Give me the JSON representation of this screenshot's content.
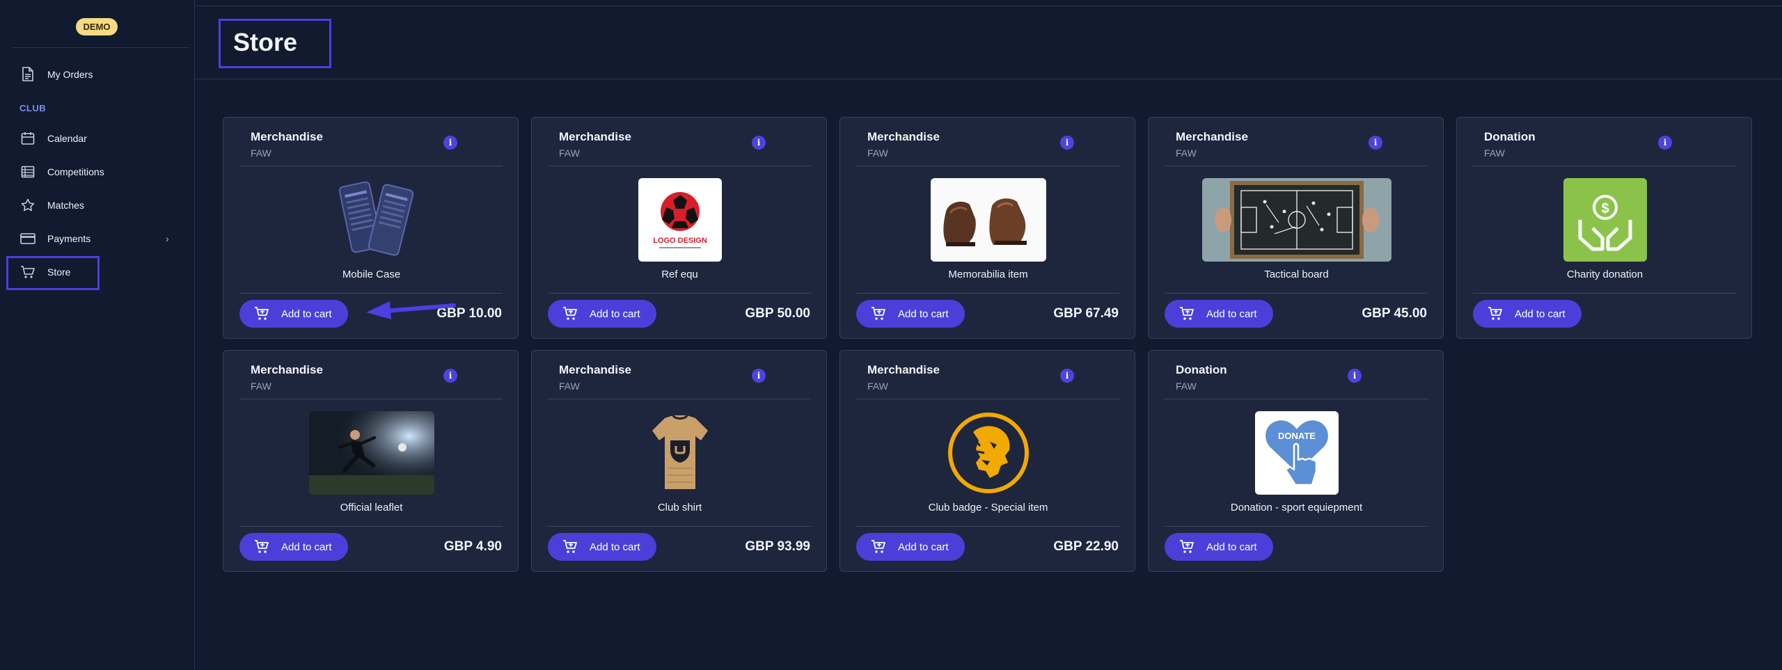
{
  "sidebar": {
    "badge": "DEMO",
    "section_label": "CLUB",
    "items": [
      {
        "label": "My Orders",
        "icon": "document-icon"
      },
      {
        "label": "Calendar",
        "icon": "calendar-icon"
      },
      {
        "label": "Competitions",
        "icon": "list-icon"
      },
      {
        "label": "Matches",
        "icon": "star-icon"
      },
      {
        "label": "Payments",
        "icon": "card-icon"
      },
      {
        "label": "Store",
        "icon": "cart-icon"
      }
    ],
    "payments_chevron": "›"
  },
  "header": {
    "title": "Store"
  },
  "store": {
    "add_label": "Add to cart",
    "info_glyph": "i",
    "products": [
      {
        "category": "Merchandise",
        "org": "FAW",
        "name": "Mobile Case",
        "price": "GBP 10.00"
      },
      {
        "category": "Merchandise",
        "org": "FAW",
        "name": "Ref equ",
        "price": "GBP 50.00",
        "logo_text": "LOGO DESIGN"
      },
      {
        "category": "Merchandise",
        "org": "FAW",
        "name": "Memorabilia item",
        "price": "GBP 67.49"
      },
      {
        "category": "Merchandise",
        "org": "FAW",
        "name": "Tactical board",
        "price": "GBP 45.00"
      },
      {
        "category": "Donation",
        "org": "FAW",
        "name": "Charity donation",
        "price": ""
      },
      {
        "category": "Merchandise",
        "org": "FAW",
        "name": "Official leaflet",
        "price": "GBP 4.90"
      },
      {
        "category": "Merchandise",
        "org": "FAW",
        "name": "Club shirt",
        "price": "GBP 93.99"
      },
      {
        "category": "Merchandise",
        "org": "FAW",
        "name": "Club badge - Special item",
        "price": "GBP 22.90"
      },
      {
        "category": "Donation",
        "org": "FAW",
        "name": "Donation - sport equiepment",
        "price": "",
        "image_text": "DONATE"
      }
    ]
  },
  "colors": {
    "accent": "#4a40d9",
    "background": "#111a2e",
    "card": "#1d263d",
    "badge": "#f5d985"
  }
}
